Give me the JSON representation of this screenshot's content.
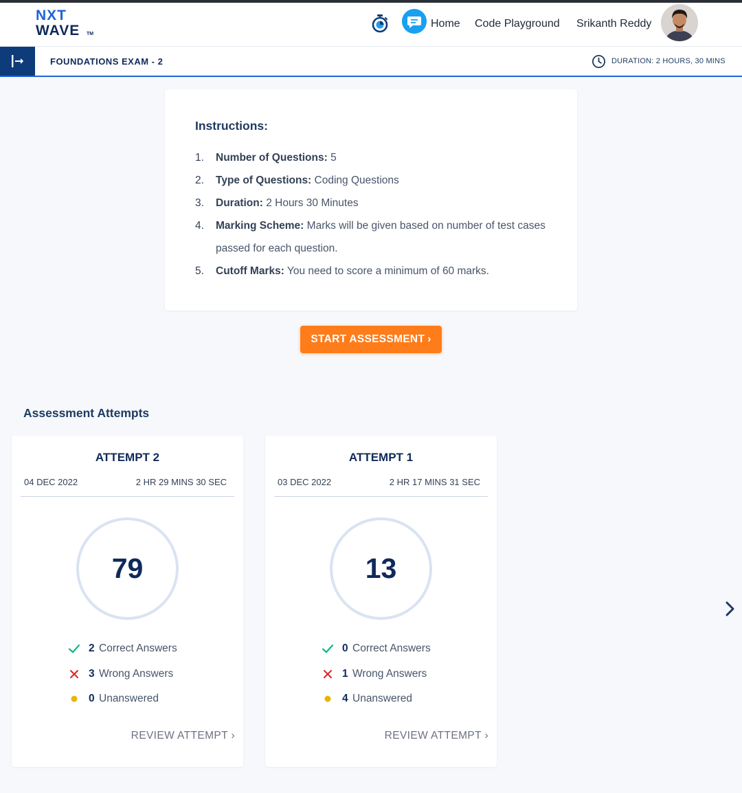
{
  "brand": {
    "line1": "NXT",
    "line2": "WAVE",
    "tm": "TM"
  },
  "nav": {
    "home": "Home",
    "code_playground": "Code Playground",
    "user_name": "Srikanth Reddy"
  },
  "exam": {
    "title": "FOUNDATIONS EXAM - 2",
    "duration": "DURATION: 2 HOURS, 30 MINS"
  },
  "instructions": {
    "heading": "Instructions:",
    "items": [
      {
        "num": "1.",
        "label": "Number of Questions:",
        "text": " 5"
      },
      {
        "num": "2.",
        "label": "Type of Questions:",
        "text": " Coding Questions"
      },
      {
        "num": "3.",
        "label": "Duration:",
        "text": " 2 Hours 30 Minutes"
      },
      {
        "num": "4.",
        "label": "Marking Scheme:",
        "text": " Marks will be given based on number of test cases passed for each question."
      },
      {
        "num": "5.",
        "label": "Cutoff Marks:",
        "text": " You need to score a minimum of 60 marks."
      }
    ]
  },
  "start_button": {
    "label": "START ASSESSMENT",
    "chevron": "›"
  },
  "attempts": {
    "heading": "Assessment Attempts",
    "review_label": "REVIEW ATTEMPT",
    "review_chevron": "›",
    "labels": {
      "correct": "Correct Answers",
      "wrong": "Wrong Answers",
      "unanswered": "Unanswered"
    },
    "items": [
      {
        "title": "ATTEMPT 2",
        "date": "04 DEC 2022",
        "time": "2 HR 29 MINS 30 SEC",
        "score": "79",
        "correct": "2",
        "wrong": "3",
        "unanswered": "0"
      },
      {
        "title": "ATTEMPT 1",
        "date": "03 DEC 2022",
        "time": "2 HR 17 MINS 31 SEC",
        "score": "13",
        "correct": "0",
        "wrong": "1",
        "unanswered": "4"
      }
    ]
  },
  "colors": {
    "brand_blue": "#1e63d6",
    "navy": "#0f2a5a",
    "accent_orange": "#ff7c1a",
    "correct_green": "#10b981",
    "wrong_red": "#dc2626",
    "unanswered_yellow": "#eab308"
  },
  "icons": {
    "timer": "stopwatch-icon",
    "chat": "chat-bubble-icon",
    "sidebar": "sidebar-toggle-icon",
    "clock": "clock-icon",
    "correct": "check-icon",
    "wrong": "cross-icon",
    "unanswered": "dot-icon",
    "next": "chevron-right-icon"
  }
}
